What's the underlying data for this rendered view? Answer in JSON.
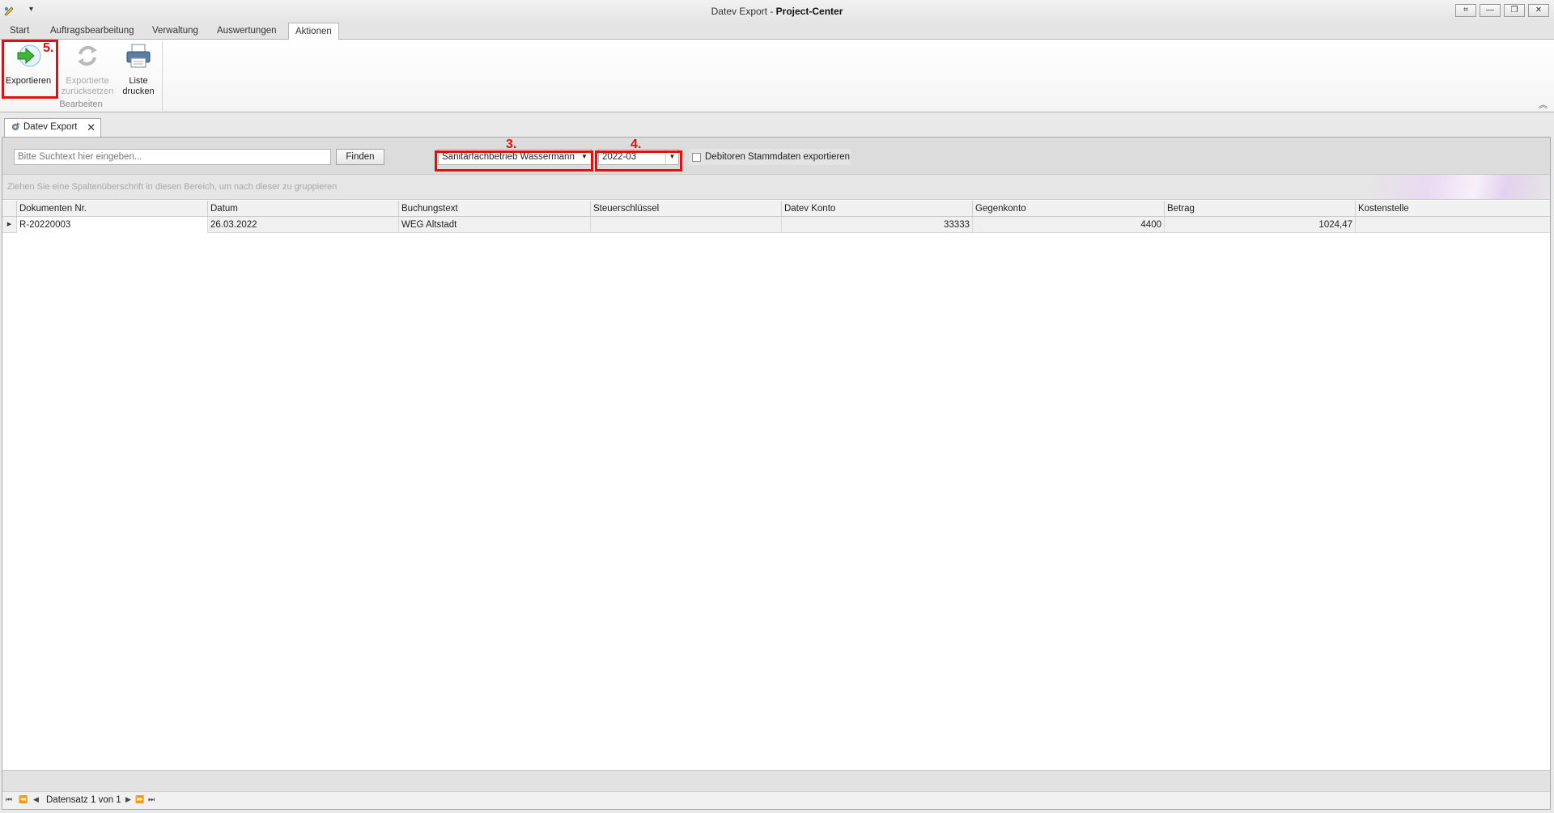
{
  "window": {
    "title_prefix": "Datev Export - ",
    "title_app": "Project-Center",
    "qat_dropdown": "▾",
    "buttons": {
      "screenshot": "⌗",
      "minimize": "—",
      "restore": "❐",
      "close": "✕"
    }
  },
  "ribbon": {
    "tabs": [
      "Start",
      "Auftragsbearbeitung",
      "Verwaltung",
      "Auswertungen",
      "Aktionen"
    ],
    "active_tab": "Aktionen",
    "buttons": {
      "export": {
        "label": "Exportieren",
        "icon": "green-arrow-right-icon"
      },
      "reset": {
        "label_line1": "Exportierte",
        "label_line2": "zurücksetzen",
        "icon": "refresh-icon"
      },
      "print": {
        "label_line1": "Liste",
        "label_line2": "drucken",
        "icon": "printer-icon"
      }
    },
    "group_label": "Bearbeiten",
    "collapse_icon": "︽"
  },
  "document_tab": {
    "label": "Datev Export",
    "close": "✕"
  },
  "filters": {
    "search_placeholder": "Bitte Suchtext hier eingeben...",
    "find_button": "Finden",
    "company_value": "Sanitärfachbetrieb Wassermann",
    "period_value": "2022-03",
    "checkbox_label": "Debitoren Stammdaten exportieren",
    "checkbox_checked": false
  },
  "annotations": {
    "step3": "3.",
    "step4": "4.",
    "step5": "5.",
    "color": "#e01010"
  },
  "grid": {
    "group_hint": "Ziehen Sie eine Spaltenüberschrift in diesen Bereich, um nach dieser zu gruppieren",
    "columns": [
      "Dokumenten Nr.",
      "Datum",
      "Buchungstext",
      "Steuerschlüssel",
      "Datev Konto",
      "Gegenkonto",
      "Betrag",
      "Kostenstelle"
    ],
    "rows": [
      [
        "R-20220003",
        "26.03.2022",
        "WEG Altstadt",
        "",
        "33333",
        "4400",
        "1024,47",
        ""
      ]
    ]
  },
  "navigator": {
    "first": "⏮",
    "prev_page": "⏪",
    "prev": "◀",
    "next": "▶",
    "next_page": "⏩",
    "last": "⏭",
    "record_text": "Datensatz 1 von 1"
  }
}
